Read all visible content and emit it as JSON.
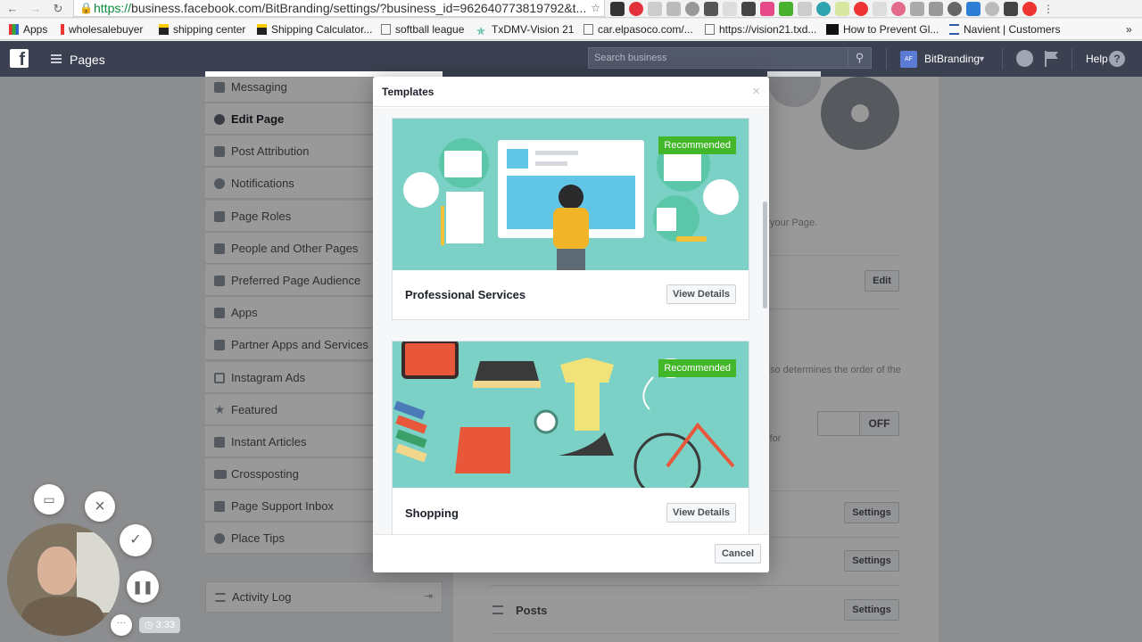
{
  "browser": {
    "url_scheme": "https://",
    "url_rest": "business.facebook.com/BitBranding/settings/?business_id=962640773819792&t...",
    "bookmarks": [
      {
        "label": "Apps",
        "icon": "apps-grid-icon"
      },
      {
        "label": "wholesalebuyer",
        "icon": "bookmark-icon"
      },
      {
        "label": "shipping center",
        "icon": "bookmark-icon"
      },
      {
        "label": "Shipping Calculator...",
        "icon": "bookmark-icon"
      },
      {
        "label": "softball league",
        "icon": "page-icon"
      },
      {
        "label": "TxDMV-Vision 21",
        "icon": "star-icon"
      },
      {
        "label": "car.elpasoco.com/...",
        "icon": "page-icon"
      },
      {
        "label": "https://vision21.txd...",
        "icon": "page-icon"
      },
      {
        "label": "How to Prevent Gl...",
        "icon": "rw-icon"
      },
      {
        "label": "Navient | Customers",
        "icon": "navient-icon"
      }
    ],
    "more": "»"
  },
  "topbar": {
    "section": "Pages",
    "search_placeholder": "Search business",
    "account_initials": "AF",
    "account_name": "BitBranding",
    "help": "Help",
    "help_icon": "?"
  },
  "sidebar": {
    "items": [
      {
        "label": "Messaging",
        "icon": "messaging-icon"
      },
      {
        "label": "Edit Page",
        "icon": "gear-icon",
        "active": true
      },
      {
        "label": "Post Attribution",
        "icon": "flag-icon"
      },
      {
        "label": "Notifications",
        "icon": "globe-icon"
      },
      {
        "label": "Page Roles",
        "icon": "person-icon"
      },
      {
        "label": "People and Other Pages",
        "icon": "people-icon"
      },
      {
        "label": "Preferred Page Audience",
        "icon": "audience-icon"
      },
      {
        "label": "Apps",
        "icon": "apps-icon"
      },
      {
        "label": "Partner Apps and Services",
        "icon": "partner-icon"
      },
      {
        "label": "Instagram Ads",
        "icon": "instagram-icon"
      },
      {
        "label": "Featured",
        "icon": "star-icon"
      },
      {
        "label": "Instant Articles",
        "icon": "articles-icon"
      },
      {
        "label": "Crossposting",
        "icon": "video-icon"
      },
      {
        "label": "Page Support Inbox",
        "icon": "inbox-icon"
      },
      {
        "label": "Place Tips",
        "icon": "tips-icon"
      }
    ],
    "activity_log": "Activity Log"
  },
  "main": {
    "hint_1": "your Page.",
    "hint_2": "so determines the order of the",
    "hint_3": "ul for",
    "edit_button": "Edit",
    "toggle_state": "OFF",
    "settings_button": "Settings",
    "posts_label": "Posts"
  },
  "modal": {
    "title": "Templates",
    "close": "×",
    "templates": [
      {
        "name": "Professional Services",
        "badge": "Recommended",
        "button": "View Details"
      },
      {
        "name": "Shopping",
        "badge": "Recommended",
        "button": "View Details"
      }
    ],
    "cancel": "Cancel"
  },
  "recorder": {
    "time": "3:33",
    "more": "···"
  },
  "colors": {
    "fb_bar": "#3b4151",
    "card_bg": "#7bd1c5",
    "badge": "#42b72a"
  }
}
